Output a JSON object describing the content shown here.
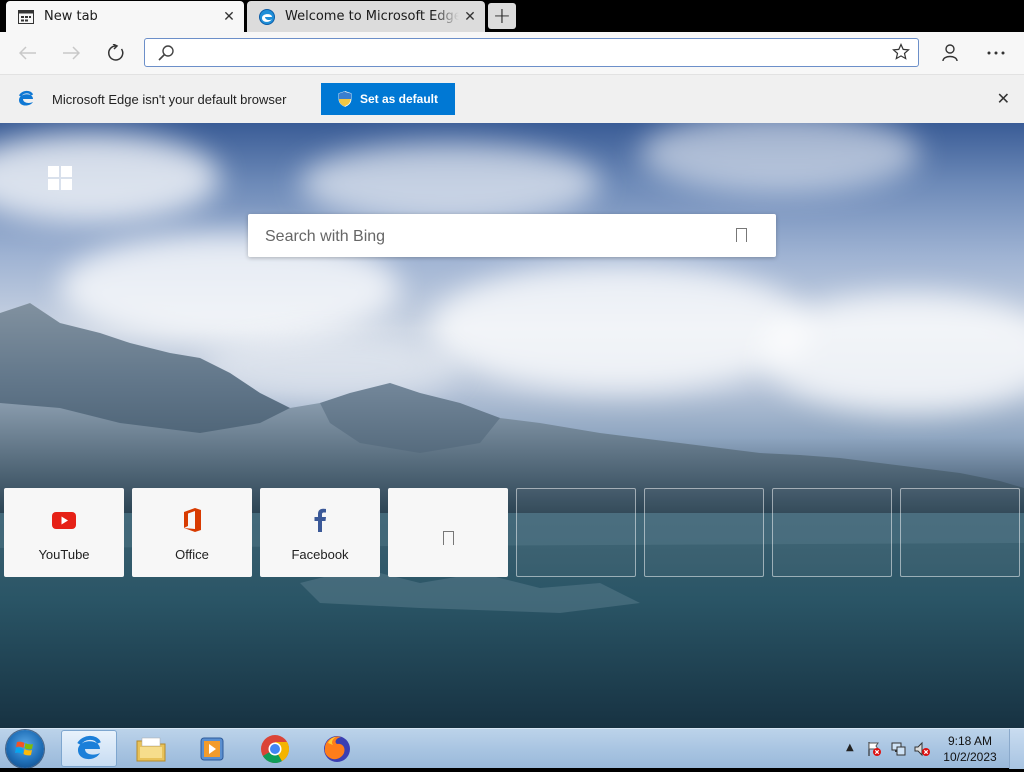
{
  "tabs": [
    {
      "label": "New tab",
      "icon": "newtab-page-icon",
      "active": true
    },
    {
      "label": "Welcome to Microsoft Edge Beta",
      "icon": "edge-icon",
      "active": false
    }
  ],
  "toolbar": {
    "address_value": "",
    "address_placeholder": ""
  },
  "infobar": {
    "message": "Microsoft Edge isn't your default browser",
    "button_label": "Set as default"
  },
  "newtab": {
    "search_placeholder": "Search with Bing",
    "top_sites": [
      {
        "label": "YouTube",
        "icon": "youtube-icon"
      },
      {
        "label": "Office",
        "icon": "office-icon"
      },
      {
        "label": "Facebook",
        "icon": "facebook-icon"
      },
      {
        "label": "",
        "icon": "placeholder-icon"
      }
    ]
  },
  "taskbar": {
    "apps": [
      "edge-icon",
      "file-explorer-icon",
      "media-player-icon",
      "chrome-icon",
      "firefox-icon"
    ],
    "time": "9:18 AM",
    "date": "10/2/2023"
  },
  "colors": {
    "accent": "#0078d4",
    "tab_active": "#f7f7f7",
    "tabstrip": "#000000"
  }
}
